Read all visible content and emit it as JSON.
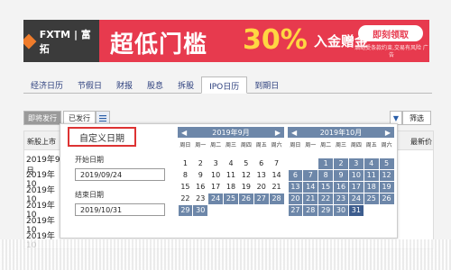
{
  "banner": {
    "logo": "FXTM | 富拓",
    "headline": "超低门槛",
    "percent": "30%",
    "bonus": "入金赠金",
    "cta": "即刻领取",
    "disclaimer": "活动受条款约束,交易有风险 广告"
  },
  "tabs": [
    "经济日历",
    "节假日",
    "财报",
    "股息",
    "拆股",
    "IPO日历",
    "到期日"
  ],
  "active_tab": "IPO日历",
  "subbar": {
    "upcoming": "即将发行",
    "issued": "已发行",
    "filter": "筛选"
  },
  "table": {
    "col_new": "新股上市",
    "col_price": "最新价",
    "dates": [
      "2019年9月",
      "2019年10",
      "2019年10",
      "2019年10",
      "2019年10",
      "2019年10"
    ]
  },
  "popup": {
    "custom_label": "自定义日期",
    "start_label": "开始日期",
    "start_value": "2019/09/24",
    "end_label": "结束日期",
    "end_value": "2019/10/31"
  },
  "calendars": [
    {
      "title": "2019年9月",
      "weekdays": [
        "周日",
        "周一",
        "周二",
        "周三",
        "周四",
        "周五",
        "周六"
      ],
      "lead_blanks": 0,
      "days": 30,
      "selected_from": 24,
      "selected_to": 30
    },
    {
      "title": "2019年10月",
      "weekdays": [
        "周日",
        "周一",
        "周二",
        "周三",
        "周四",
        "周五",
        "周六"
      ],
      "lead_blanks": 2,
      "days": 31,
      "selected_from": 1,
      "selected_to": 31
    }
  ],
  "colors": {
    "accent": "#6d87a9",
    "banner": "#e73a4e",
    "highlight": "#d33333"
  }
}
